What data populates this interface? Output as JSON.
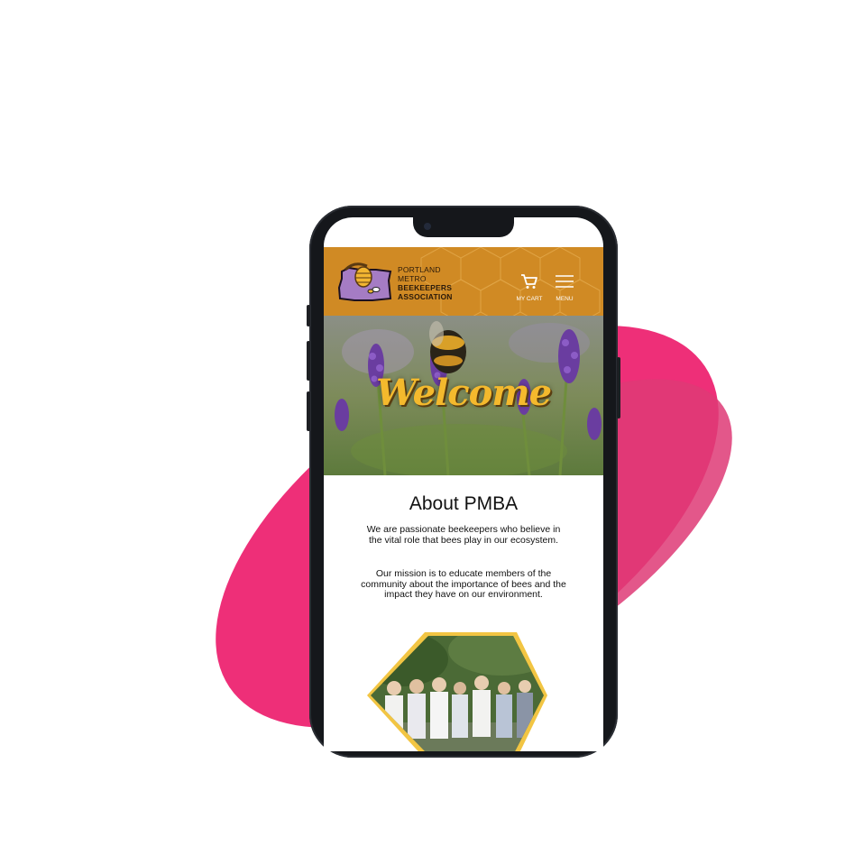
{
  "header": {
    "logo_line1": "PORTLAND",
    "logo_line2": "METRO",
    "logo_line3": "BEEKEEPERS",
    "logo_line4": "ASSOCIATION",
    "cart_label": "MY CART",
    "menu_label": "MENU"
  },
  "hero": {
    "welcome_text": "Welcome"
  },
  "about": {
    "title": "About PMBA",
    "para1": "We are passionate beekeepers who believe in the vital role that bees play in our ecosystem.",
    "para2": "Our mission is to educate members of the community about the importance of bees and the impact they have on our environment."
  },
  "colors": {
    "header_bg": "#d08a24",
    "accent_pink": "#ee2f78",
    "welcome_yellow": "#f4b92d",
    "oregon_purple": "#a57cc4",
    "hex_border": "#f2c543"
  },
  "icons": [
    "oregon-logo-icon",
    "cart-icon",
    "hamburger-menu-icon"
  ]
}
